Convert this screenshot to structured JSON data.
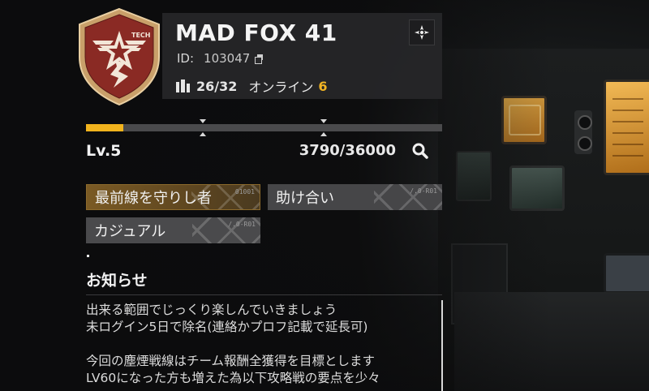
{
  "clan": {
    "name": "MAD FOX 41",
    "id_label": "ID:",
    "id_value": "103047",
    "emblem_text": "TECH",
    "members": "26/32",
    "online_label": "オンライン",
    "online_count": "6"
  },
  "progress": {
    "level": "Lv.5",
    "xp": "3790/36000",
    "xp_fraction": 0.105
  },
  "tags": [
    {
      "label": "最前線を守りし者",
      "code": "01001",
      "style": "gold"
    },
    {
      "label": "助け合い",
      "code": "/.0-R01",
      "style": "gray"
    },
    {
      "label": "カジュアル",
      "code": "/.0-R01",
      "style": "gray"
    }
  ],
  "notice": {
    "title": "お知らせ",
    "lines": [
      "出来る範囲でじっくり楽しんでいきましょう",
      "未ログイン5日で除名(連絡かプロフ記載で延長可)",
      "",
      "今回の塵煙戦線はチーム報酬全獲得を目標とします",
      "LV60になった方も増えた為以下攻略戦の要点を少々"
    ]
  },
  "icons": {
    "settings": "crosshair-settings-icon",
    "search": "magnifier-icon",
    "members": "members-icon",
    "copy": "copy-icon"
  },
  "colors": {
    "accent": "#f2b41d",
    "emblem_red": "#8a2a24",
    "emblem_gold": "#c9a06a"
  }
}
